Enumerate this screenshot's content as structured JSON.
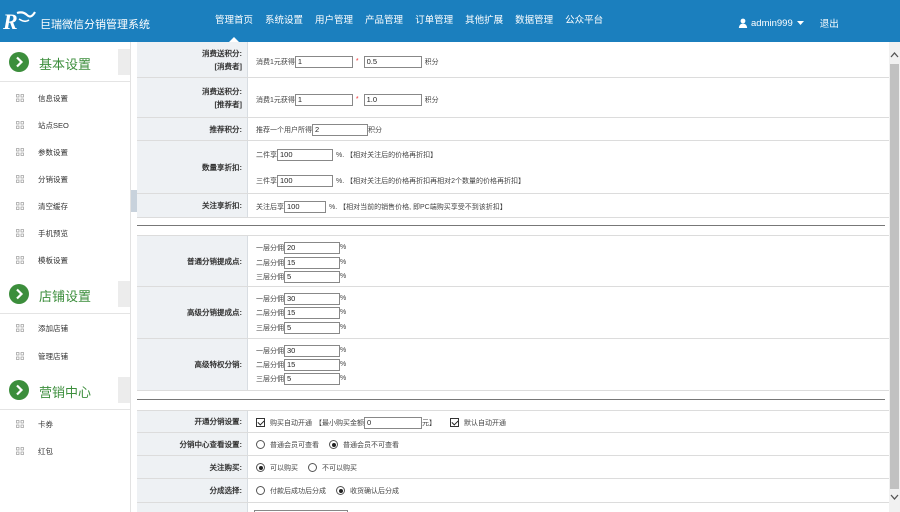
{
  "header": {
    "app_title": "巨瑞微信分销管理系统",
    "nav": [
      "管理首页",
      "系统设置",
      "用户管理",
      "产品管理",
      "订单管理",
      "其他扩展",
      "数据管理",
      "公众平台"
    ],
    "active_nav": 0,
    "username": "admin999",
    "logout": "退出"
  },
  "sidebar": {
    "sections": [
      {
        "title": "基本设置",
        "items": [
          "信息设置",
          "站点SEO",
          "参数设置",
          "分销设置",
          "清空缓存",
          "手机预览",
          "模板设置"
        ]
      },
      {
        "title": "店铺设置",
        "items": [
          "添加店铺",
          "管理店铺"
        ]
      },
      {
        "title": "营销中心",
        "items": [
          "卡券",
          "红包"
        ]
      }
    ]
  },
  "form": {
    "consume_buyer": {
      "label1": "消费送积分:",
      "label2": "[消费者]",
      "prefix": "消费1元获得",
      "value1": "1",
      "value2": "0.5",
      "suffix": "积分"
    },
    "consume_ref": {
      "label1": "消费送积分:",
      "label2": "[推荐者]",
      "prefix": "消费1元获得",
      "value1": "1",
      "value2": "1.0",
      "suffix": "积分"
    },
    "recommend_points": {
      "label": "推荐积分:",
      "prefix": "推荐一个用户所得",
      "value": "2",
      "suffix": "积分"
    },
    "qty_discount": {
      "label": "数量享折扣:",
      "line1": {
        "prefix": "二件享",
        "value": "100",
        "suffix": "%. 【相对关注后的价格再折扣】"
      },
      "line2": {
        "prefix": "三件享",
        "value": "100",
        "suffix": "%. 【相对关注后的价格再折扣再相对2个数量的价格再折扣】"
      }
    },
    "follow_discount": {
      "label": "关注享折扣:",
      "prefix": "关注后享",
      "value": "100",
      "suffix": "%. 【相对当前的销售价格, 即PC端购买享受不到该折扣】"
    },
    "normal_dist": {
      "label": "普通分销提成点:",
      "levels": [
        {
          "label": "一层分佣",
          "value": "20"
        },
        {
          "label": "二层分佣",
          "value": "15"
        },
        {
          "label": "三层分佣",
          "value": "5"
        }
      ],
      "unit": "%"
    },
    "senior_dist": {
      "label": "高级分销提成点:",
      "levels": [
        {
          "label": "一层分佣",
          "value": "30"
        },
        {
          "label": "二层分佣",
          "value": "15"
        },
        {
          "label": "三层分佣",
          "value": "5"
        }
      ],
      "unit": "%"
    },
    "privilege_dist": {
      "label": "高级特权分销:",
      "levels": [
        {
          "label": "一层分佣",
          "value": "30"
        },
        {
          "label": "二层分佣",
          "value": "15"
        },
        {
          "label": "三层分佣",
          "value": "5"
        }
      ],
      "unit": "%"
    },
    "open_dist": {
      "label": "开通分销设置:",
      "opt1": "购买自动开通",
      "min_label": "【最小购买金额",
      "min_value": "0",
      "min_suffix": "元】",
      "opt2": "默认自动开通"
    },
    "dist_center": {
      "label": "分销中心查看设置:",
      "opt1": "普通会员可查看",
      "opt2": "普通会员不可查看",
      "selected": 1
    },
    "follow_buy": {
      "label": "关注购买:",
      "opt1": "可以购买",
      "opt2": "不可以购买",
      "selected": 0
    },
    "split_choice": {
      "label": "分成选择:",
      "opt1": "付款后成功后分成",
      "opt2": "收货确认后分成",
      "selected": 1
    }
  }
}
